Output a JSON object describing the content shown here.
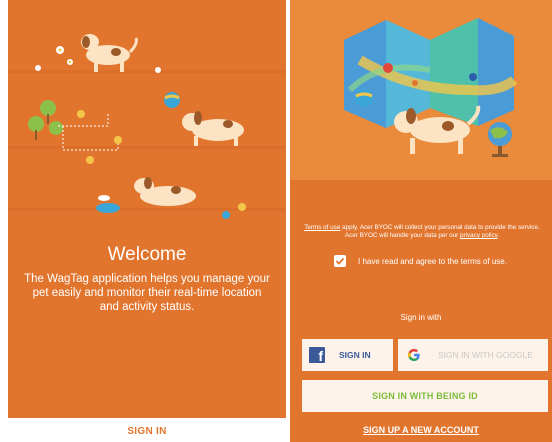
{
  "welcome_screen": {
    "title": "Welcome",
    "body": "The WagTag application helps you manage your pet easily and monitor their real-time location and activity status.",
    "signin_label": "SIGN IN",
    "colors": {
      "primary": "#e2752d",
      "text_on_primary": "#ffffff"
    }
  },
  "signin_screen": {
    "terms": {
      "link1": "Terms of use",
      "mid": " apply. Acer BYOC will collect your personal data to provide the service. Acer BYOC will handle your data per our ",
      "link2": "privacy policy",
      "end": "."
    },
    "agree_label": "I have read and agree to the terms of use.",
    "agree_checked": true,
    "signin_with": "Sign in with",
    "facebook_label": "SIGN IN",
    "google_label": "SIGN IN WITH GOOGLE",
    "being_id_label": "SIGN IN WITH BEING ID",
    "signup_label": "SIGN UP A NEW ACCOUNT",
    "colors": {
      "facebook": "#3b5998",
      "being_id": "#7bbd3b",
      "button_bg": "#fdf3ea"
    }
  }
}
